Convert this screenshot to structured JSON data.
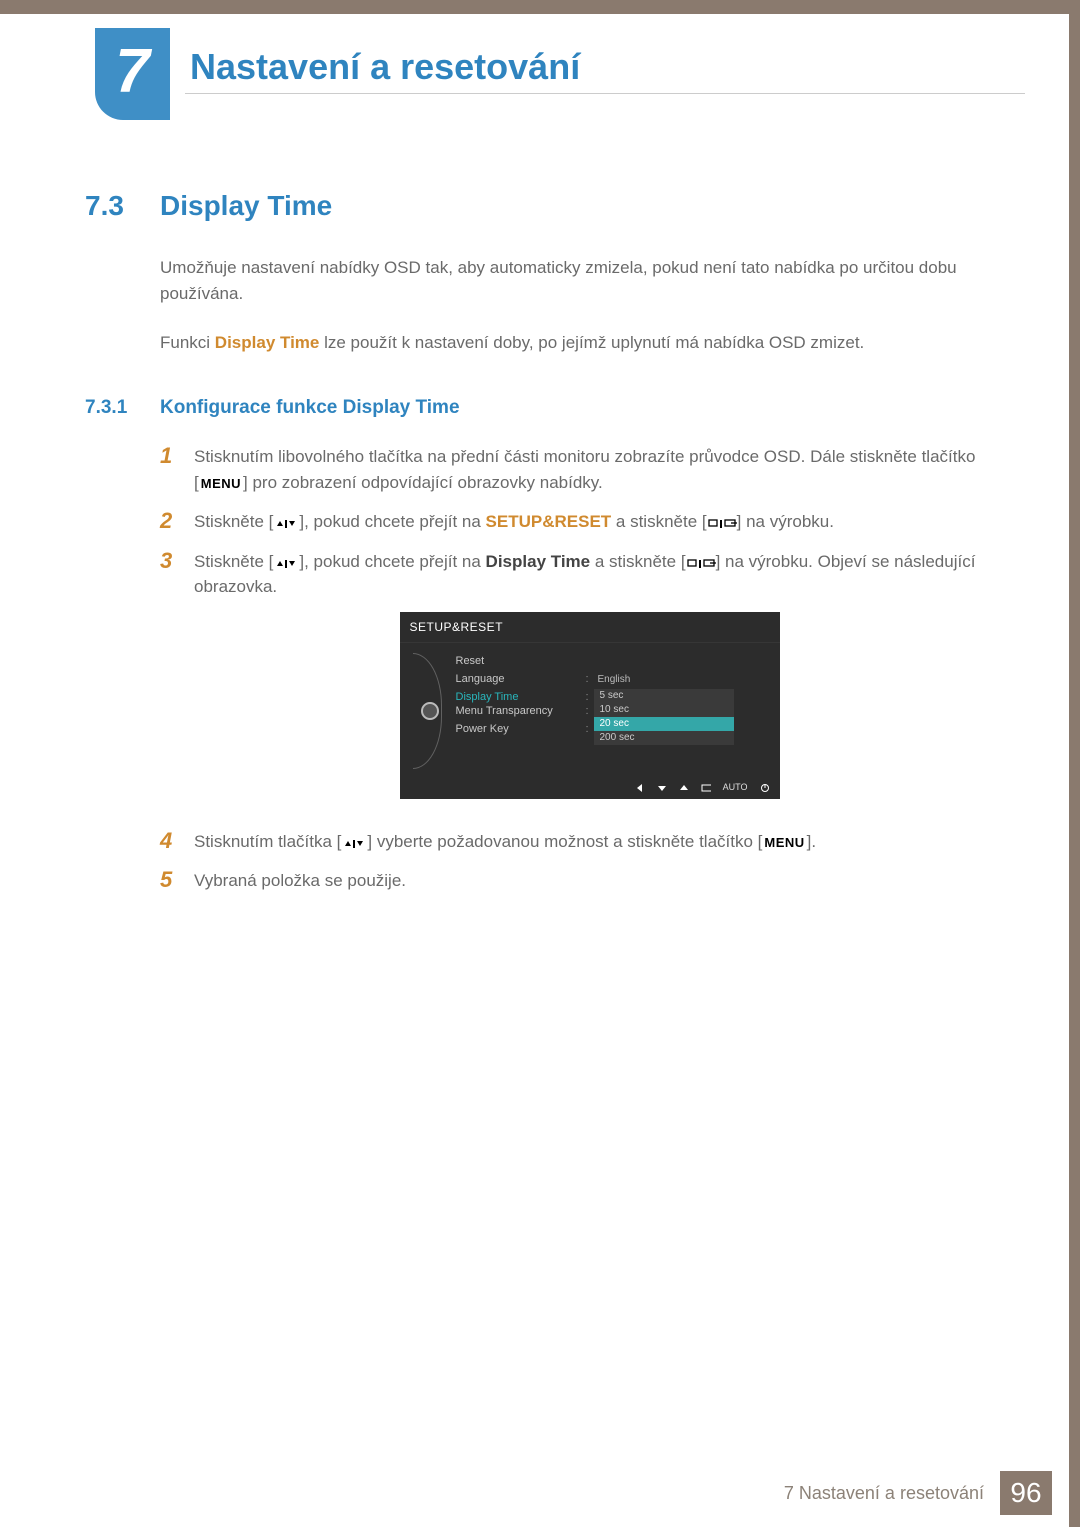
{
  "chapter": {
    "number": "7",
    "title": "Nastavení a resetování"
  },
  "section": {
    "number": "7.3",
    "title": "Display Time"
  },
  "intro1": "Umožňuje nastavení nabídky OSD tak, aby automaticky zmizela, pokud není tato nabídka po určitou dobu používána.",
  "intro2_pre": "Funkci ",
  "intro2_hl": "Display Time",
  "intro2_post": " lze použít k nastavení doby, po jejímž uplynutí má nabídka OSD zmizet.",
  "subsection": {
    "number": "7.3.1",
    "title": "Konfigurace funkce Display Time"
  },
  "steps": {
    "s1a": "Stisknutím libovolného tlačítka na přední části monitoru zobrazíte průvodce OSD. Dále stiskněte tlačítko [",
    "s1b": "] pro zobrazení odpovídající obrazovky nabídky.",
    "s2a": "Stiskněte [",
    "s2b": "], pokud chcete přejít na ",
    "s2hl": "SETUP&RESET",
    "s2c": " a stiskněte [",
    "s2d": "] na výrobku.",
    "s3a": "Stiskněte [",
    "s3b": "], pokud chcete přejít na ",
    "s3hl": "Display Time",
    "s3c": " a stiskněte [",
    "s3d": "] na výrobku. Objeví se následující obrazovka.",
    "s4a": "Stisknutím tlačítka [",
    "s4b": "] vyberte požadovanou možnost a stiskněte tlačítko [",
    "s4c": "].",
    "s5": "Vybraná položka se použije."
  },
  "menu_label": "MENU",
  "osd": {
    "title": "SETUP&RESET",
    "rows": [
      {
        "label": "Reset",
        "value": ""
      },
      {
        "label": "Language",
        "value": "English"
      },
      {
        "label": "Display Time",
        "value": "",
        "selected": true
      },
      {
        "label": "Menu Transparency",
        "value": ""
      },
      {
        "label": "Power Key",
        "value": ""
      }
    ],
    "options": [
      "5 sec",
      "10 sec",
      "20 sec",
      "200 sec"
    ],
    "highlight_index": 2,
    "footer_auto": "AUTO"
  },
  "footer": {
    "text": "7 Nastavení a resetování",
    "page": "96"
  }
}
